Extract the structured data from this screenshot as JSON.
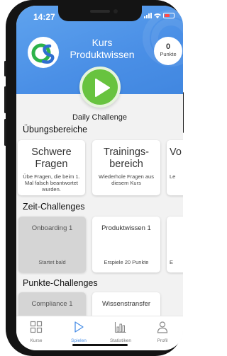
{
  "status": {
    "time": "14:27"
  },
  "header": {
    "title_line1": "Kurs",
    "title_line2": "Produktwissen",
    "points_value": "0",
    "points_label": "Punkte"
  },
  "daily_challenge_label": "Daily Challenge",
  "uebungsbereiche": {
    "title": "Übungsbereiche",
    "cards": [
      {
        "title_line1": "Schwere",
        "title_line2": "Fragen",
        "description": "Übe Fragen, die beim 1. Mal falsch beantwortet wurden."
      },
      {
        "title_line1": "Trainings-",
        "title_line2": "bereich",
        "description": "Wiederhole Fragen aus diesem Kurs"
      },
      {
        "title_line1": "Vo",
        "description": "Le"
      }
    ]
  },
  "zeit_challenges": {
    "title": "Zeit-Challenges",
    "cards": [
      {
        "title": "Onboarding 1",
        "footer": "Startet bald",
        "state": "disabled"
      },
      {
        "title": "Produktwissen 1",
        "footer": "Erspiele 20 Punkte",
        "state": "active"
      },
      {
        "footer": "E"
      }
    ]
  },
  "punkte_challenges": {
    "title": "Punkte-Challenges",
    "cards": [
      {
        "title": "Compliance 1",
        "state": "disabled"
      },
      {
        "title": "Wissenstransfer",
        "state": "active"
      }
    ]
  },
  "tabbar": {
    "items": [
      {
        "label": "Kurse",
        "icon": "grid-icon"
      },
      {
        "label": "Spielen",
        "icon": "play-outline-icon",
        "active": true
      },
      {
        "label": "Statistiken",
        "icon": "bar-chart-icon"
      },
      {
        "label": "Profil",
        "icon": "person-icon"
      }
    ]
  },
  "colors": {
    "header_blue": "#4a8fe6",
    "play_green": "#68c33f",
    "active_tab": "#4a8fe6",
    "logo_green": "#2db34a",
    "logo_blue": "#2f6fd0"
  }
}
